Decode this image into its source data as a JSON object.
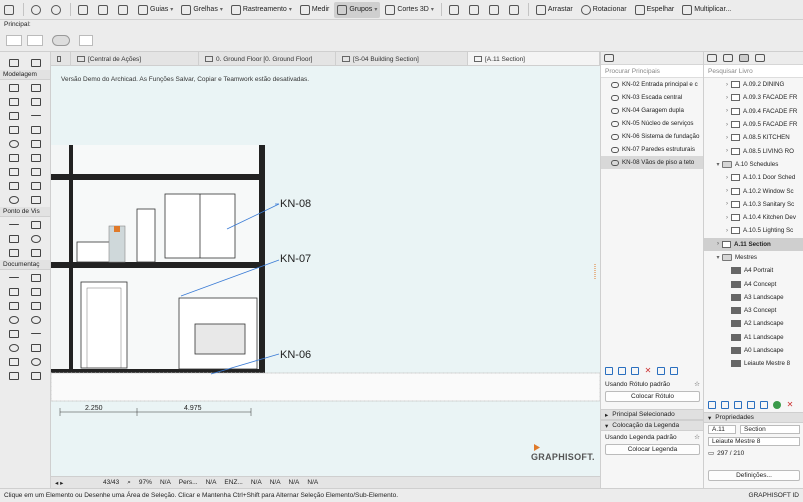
{
  "toolbar": {
    "guias": "Guias",
    "grelhas": "Grelhas",
    "rastreamento": "Rastreamento",
    "medir": "Medir",
    "grupos": "Grupos",
    "cortes3d": "Cortes 3D",
    "arrastar": "Arrastar",
    "rotacionar": "Rotacionar",
    "espelhar": "Espelhar",
    "multiplicar": "Multiplicar..."
  },
  "subbar": {
    "label": "Principal:"
  },
  "leftbar": {
    "modelagem": "Modelagem",
    "ponto_de_vista": "Ponto de Vis",
    "documentacao": "Documentaç"
  },
  "tabs": [
    {
      "label": "[Central de Ações]"
    },
    {
      "label": "0. Ground Floor [0. Ground Floor]"
    },
    {
      "label": "[S-04 Building Section]"
    },
    {
      "label": "[A.11 Section]"
    }
  ],
  "canvas": {
    "notice": "Versão Demo do Archicad. As Funções Salvar, Copiar e Teamwork estão desativadas.",
    "label_kn08": "KN-08",
    "label_kn07": "KN-07",
    "label_kn06": "KN-06",
    "dim_a": "2.250",
    "dim_b": "4.975",
    "brand": "GRAPHISOFT."
  },
  "statusbar": {
    "pages": "43/43",
    "zoom": "97%",
    "na1": "N/A",
    "pers": "Pers...",
    "na2": "N/A",
    "enz": "ENZ...",
    "na3": "N/A",
    "na4": "N/A",
    "na5": "N/A",
    "na6": "N/A"
  },
  "footer": {
    "hint": "Clique em um Elemento ou Desenhe uma Área de Seleção. Clicar e Mantenha Ctrl+Shift para Alternar Seleção Elemento/Sub-Elemento.",
    "id": "GRAPHISOFT ID"
  },
  "navmid": {
    "search_placeholder": "Procurar Principais",
    "items": [
      {
        "label": "KN-02 Entrada principal e c"
      },
      {
        "label": "KN-03 Escada central"
      },
      {
        "label": "KN-04 Garagem dupla"
      },
      {
        "label": "KN-05 Núcleo de serviços"
      },
      {
        "label": "KN-06 Sistema de fundação"
      },
      {
        "label": "KN-07 Paredes estruturais"
      },
      {
        "label": "KN-08 Vãos de piso a teto"
      }
    ],
    "using_label": "Usando Rótulo padrão",
    "place_label_button": "Colocar Rótulo",
    "selected_principal": "Principal Selecionado",
    "legend_placement": "Colocação da Legenda",
    "using_legend": "Usando Legenda padrão",
    "place_legend_button": "Colocar Legenda"
  },
  "navright": {
    "search_placeholder": "Pesquisar Livro",
    "tree": [
      {
        "label": "A.09.2 DINING",
        "kind": "file",
        "depth": 2
      },
      {
        "label": "A.09.3 FACADE FR",
        "kind": "file",
        "depth": 2
      },
      {
        "label": "A.09.4 FACADE FR",
        "kind": "file",
        "depth": 2
      },
      {
        "label": "A.09.5 FACADE FR",
        "kind": "file",
        "depth": 2
      },
      {
        "label": "A.08.5 KITCHEN",
        "kind": "file",
        "depth": 2
      },
      {
        "label": "A.08.5 LIVING RO",
        "kind": "file",
        "depth": 2
      },
      {
        "label": "A.10 Schedules",
        "kind": "folder",
        "depth": 1
      },
      {
        "label": "A.10.1 Door Sched",
        "kind": "file",
        "depth": 2
      },
      {
        "label": "A.10.2 Window Sc",
        "kind": "file",
        "depth": 2
      },
      {
        "label": "A.10.3 Sanitary Sc",
        "kind": "file",
        "depth": 2
      },
      {
        "label": "A.10.4 Kitchen Dev",
        "kind": "file",
        "depth": 2
      },
      {
        "label": "A.10.5 Lighting Sc",
        "kind": "file",
        "depth": 2
      },
      {
        "label": "A.11 Section",
        "kind": "file",
        "depth": 1,
        "selected": true
      },
      {
        "label": "Mestres",
        "kind": "folder",
        "depth": 1
      },
      {
        "label": "A4 Portrait",
        "kind": "layout",
        "depth": 2
      },
      {
        "label": "A4 Concept",
        "kind": "layout",
        "depth": 2
      },
      {
        "label": "A3 Landscape",
        "kind": "layout",
        "depth": 2
      },
      {
        "label": "A3 Concept",
        "kind": "layout",
        "depth": 2
      },
      {
        "label": "A2 Landscape",
        "kind": "layout",
        "depth": 2
      },
      {
        "label": "A1 Landscape",
        "kind": "layout",
        "depth": 2
      },
      {
        "label": "A0 Landscape",
        "kind": "layout",
        "depth": 2
      },
      {
        "label": "Leiaute Mestre 8",
        "kind": "layout",
        "depth": 2
      }
    ],
    "properties_header": "Propriedades",
    "prop_id": "A.11",
    "prop_name": "Section",
    "master": "Leiaute Mestre 8",
    "size": "297 / 210",
    "definitions_button": "Definições..."
  }
}
